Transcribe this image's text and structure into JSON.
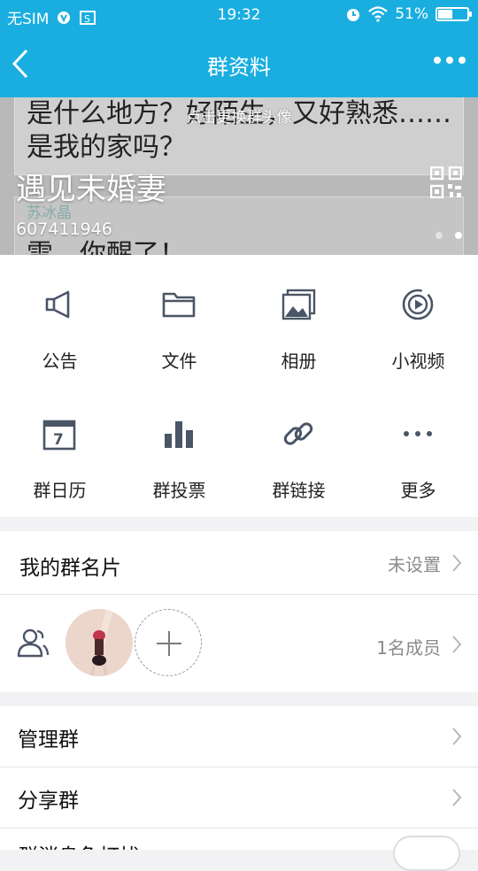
{
  "status_bar": {
    "carrier": "无SIM",
    "time": "19:32",
    "battery_percent": "51%",
    "battery_level": 0.51,
    "icons": [
      "data-icon",
      "screenshot-icon",
      "alarm-icon",
      "wifi-icon",
      "battery-icon"
    ]
  },
  "nav": {
    "title": "群资料",
    "back_icon": "chevron-left-icon",
    "more_icon": "more-dots-icon"
  },
  "hero": {
    "background_text_1": "是什么地方？好陌生，又好熟悉……是我的家吗？",
    "background_name": "苏冰晶",
    "background_text_2": "雪，你醒了！",
    "hint": "点击更换群头像",
    "group_name": "遇见未婚妻",
    "group_id": "607411946",
    "qr_icon": "qr-code-icon",
    "page_count": 2,
    "active_page": 2
  },
  "features": [
    {
      "label": "公告",
      "icon": "megaphone-icon"
    },
    {
      "label": "文件",
      "icon": "folder-icon"
    },
    {
      "label": "相册",
      "icon": "photo-album-icon"
    },
    {
      "label": "小视频",
      "icon": "video-icon"
    },
    {
      "label": "群日历",
      "icon": "calendar-icon"
    },
    {
      "label": "群投票",
      "icon": "bar-chart-icon"
    },
    {
      "label": "群链接",
      "icon": "link-icon"
    },
    {
      "label": "更多",
      "icon": "more-dots-icon"
    }
  ],
  "card": {
    "label": "我的群名片",
    "value": "未设置"
  },
  "members": {
    "count_text": "1名成员",
    "icon": "members-icon"
  },
  "menu": [
    {
      "label": "管理群"
    },
    {
      "label": "分享群"
    },
    {
      "label": "群消息免打扰"
    }
  ],
  "colors": {
    "accent": "#1aaee0",
    "text": "#111111",
    "secondary": "#8c8c8c",
    "background": "#f2f2f4"
  }
}
